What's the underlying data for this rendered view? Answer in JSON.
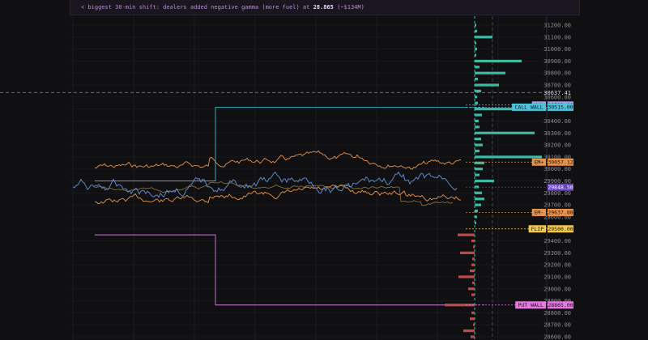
{
  "banner": {
    "prefix": "< biggest 30-min shift: dealers added negative gamma (more fuel) at ",
    "strike": "28.865",
    "suffix": " (~$134M)"
  },
  "axis": {
    "min": 28600,
    "max": 31200,
    "ticks": [
      31200,
      31100,
      31000,
      30900,
      30800,
      30700,
      30600,
      30500,
      30400,
      30300,
      30200,
      30100,
      30000,
      29900,
      29800,
      29700,
      29600,
      29500,
      29400,
      29300,
      29200,
      29100,
      29000,
      28900,
      28800,
      28700,
      28600
    ],
    "tick_labels": [
      "31200.00",
      "31100.00",
      "31000.00",
      "30900.00",
      "30800.00",
      "30700.00",
      "30600.00",
      "30500.00",
      "30400.00",
      "30300.00",
      "30200.00",
      "30100.00",
      "30000.00",
      "29900.00",
      "29800.00",
      "29700.00",
      "29600.00",
      "29500.00",
      "29400.00",
      "29300.00",
      "29200.00",
      "29100.00",
      "29000.00",
      "28900.00",
      "28800.00",
      "28700.00",
      "28600.00"
    ]
  },
  "price_line": {
    "value": 30637.41,
    "label": "30637.41"
  },
  "colors": {
    "positive_gamma": "#3fb8a4",
    "negative_gamma": "#c24a4a",
    "call_wall": "#3ab8c8",
    "put_wall": "#d679d9",
    "hvl": "#a79be8",
    "em": "#e8924a",
    "flip": "#f2c94c",
    "price": "#5d86c6",
    "current": "#7248c8"
  },
  "levels": [
    {
      "name": "hvl",
      "tag": "HVL",
      "value_label": "30533.00",
      "value": 30533,
      "color": "#a79be8",
      "text": "#1a1030"
    },
    {
      "name": "call-wall",
      "tag": "CALL WALL",
      "value_label": "30515.00",
      "value": 30515,
      "color": "#4cc3d9",
      "text": "#062028"
    },
    {
      "name": "em-upper",
      "tag": "EM+",
      "value_label": "30057.12",
      "value": 30057,
      "color": "#e8924a",
      "text": "#2a1404"
    },
    {
      "name": "current",
      "tag": "",
      "value_label": "29848.50",
      "value": 29848,
      "color": "#6a45c0",
      "text": "#ffffff"
    },
    {
      "name": "em-lower",
      "tag": "EM-",
      "value_label": "29637.88",
      "value": 29637,
      "color": "#e8924a",
      "text": "#2a1404"
    },
    {
      "name": "flip",
      "tag": "FLIP",
      "value_label": "29500.00",
      "value": 29500,
      "color": "#f2c94c",
      "text": "#2a2004"
    },
    {
      "name": "put-wall",
      "tag": "PUT WALL",
      "value_label": "28865.00",
      "value": 28865,
      "color": "#e57ae0",
      "text": "#2a0828"
    }
  ],
  "gamma_bars": [
    {
      "strike": 31200,
      "value": 2
    },
    {
      "strike": 31150,
      "value": 3
    },
    {
      "strike": 31100,
      "value": 22
    },
    {
      "strike": 31050,
      "value": 2
    },
    {
      "strike": 31000,
      "value": 3
    },
    {
      "strike": 30950,
      "value": 2
    },
    {
      "strike": 30900,
      "value": 58
    },
    {
      "strike": 30850,
      "value": 6
    },
    {
      "strike": 30800,
      "value": 38
    },
    {
      "strike": 30750,
      "value": 4
    },
    {
      "strike": 30700,
      "value": 30
    },
    {
      "strike": 30650,
      "value": 8
    },
    {
      "strike": 30600,
      "value": 3
    },
    {
      "strike": 30550,
      "value": 4
    },
    {
      "strike": 30500,
      "value": 52
    },
    {
      "strike": 30450,
      "value": 9
    },
    {
      "strike": 30400,
      "value": 5
    },
    {
      "strike": 30350,
      "value": 6
    },
    {
      "strike": 30300,
      "value": 74
    },
    {
      "strike": 30250,
      "value": 8
    },
    {
      "strike": 30200,
      "value": 10
    },
    {
      "strike": 30150,
      "value": 6
    },
    {
      "strike": 30100,
      "value": 83
    },
    {
      "strike": 30050,
      "value": 12
    },
    {
      "strike": 30000,
      "value": 10
    },
    {
      "strike": 29950,
      "value": 6
    },
    {
      "strike": 29900,
      "value": 24
    },
    {
      "strike": 29850,
      "value": 5
    },
    {
      "strike": 29800,
      "value": 9
    },
    {
      "strike": 29750,
      "value": 12
    },
    {
      "strike": 29700,
      "value": 8
    },
    {
      "strike": 29650,
      "value": 4
    },
    {
      "strike": 29600,
      "value": 3
    },
    {
      "strike": 29550,
      "value": 2
    },
    {
      "strike": 29450,
      "value": -21
    },
    {
      "strike": 29400,
      "value": -4
    },
    {
      "strike": 29350,
      "value": -2
    },
    {
      "strike": 29300,
      "value": -18
    },
    {
      "strike": 29250,
      "value": -3
    },
    {
      "strike": 29200,
      "value": -4
    },
    {
      "strike": 29150,
      "value": -6
    },
    {
      "strike": 29100,
      "value": -20
    },
    {
      "strike": 29050,
      "value": -3
    },
    {
      "strike": 29000,
      "value": -8
    },
    {
      "strike": 28950,
      "value": -4
    },
    {
      "strike": 28865,
      "value": -37
    },
    {
      "strike": 28800,
      "value": -4
    },
    {
      "strike": 28750,
      "value": -6
    },
    {
      "strike": 28700,
      "value": -2
    },
    {
      "strike": 28650,
      "value": -14
    },
    {
      "strike": 28600,
      "value": -5
    }
  ]
}
